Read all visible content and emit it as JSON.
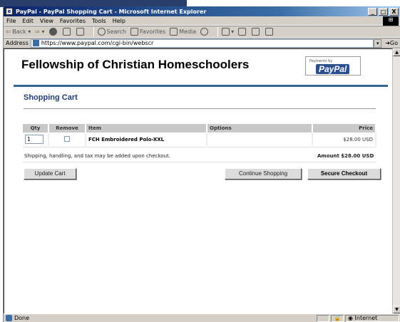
{
  "window": {
    "title": "PayPal - PayPal Shopping Cart - Microsoft Internet Explorer",
    "controls": {
      "minimize": "_",
      "maximize": "□",
      "close": "X"
    }
  },
  "menu": [
    "File",
    "Edit",
    "View",
    "Favorites",
    "Tools",
    "Help"
  ],
  "toolbar": {
    "back": "Back",
    "search": "Search",
    "favorites": "Favorites",
    "media": "Media"
  },
  "address": {
    "label": "Address",
    "url": "https://www.paypal.com/cgi-bin/webscr",
    "go": "Go"
  },
  "page": {
    "org_title": "Fellowship of Christian Homeschoolers",
    "badge_small": "Payments by",
    "badge_logo": "PayPal",
    "cart_title": "Shopping Cart"
  },
  "cart": {
    "headers": {
      "qty": "Qty",
      "remove": "Remove",
      "item": "Item",
      "options": "Options",
      "price": "Price"
    },
    "rows": [
      {
        "qty": "1",
        "item": "FCH Embroidered Polo-XXL",
        "options": "",
        "price": "$28.00 USD"
      }
    ],
    "footnote": "Shipping, handling, and tax may be added upon checkout.",
    "amount": "Amount $28.00 USD"
  },
  "buttons": {
    "update": "Update Cart",
    "continue": "Continue Shopping",
    "checkout": "Secure Checkout"
  },
  "status": {
    "text": "Done",
    "zone": "Internet"
  },
  "colors": {
    "title_blue": "#1f3d77",
    "header_rule": "#336699",
    "titlebar": "#0a246a"
  }
}
